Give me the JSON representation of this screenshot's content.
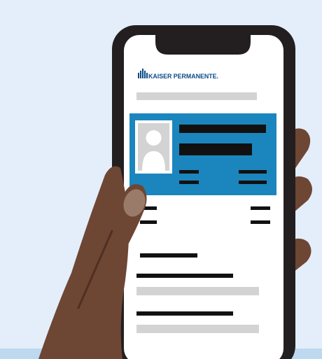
{
  "brand": {
    "logo_text": "KAISER PERMANENTE.",
    "logo_icon": "kp-logo-icon",
    "brand_color": "#0d4a86"
  },
  "colors": {
    "background": "#e3eefa",
    "bottom_band": "#bcd9ef",
    "phone_frame": "#231f20",
    "card": "#1b86bd",
    "skin": "#6e4634",
    "skin_dark": "#4f3022",
    "nail": "#9a7a68",
    "placeholder_gray": "#d3d3d3",
    "text_bar": "#111111"
  },
  "member_card": {
    "avatar_icon": "person-placeholder-icon"
  }
}
